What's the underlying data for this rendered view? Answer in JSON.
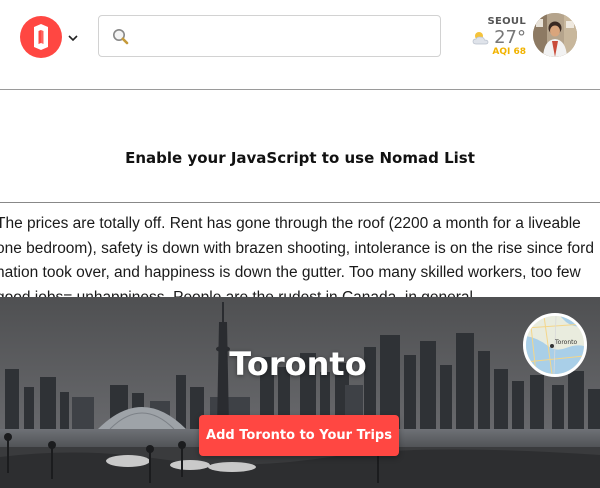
{
  "header": {
    "logo_icon": "nomad-list-logo",
    "logo_color": "#ff4742",
    "menu_icon": "chevron-down-icon",
    "search": {
      "icon": "search-icon",
      "value": "",
      "placeholder": ""
    },
    "weather": {
      "city": "SEOUL",
      "temperature": "27°",
      "aqi": "AQI 68",
      "icon": "partly-cloudy-icon",
      "aqi_color": "#f2b300"
    },
    "avatar_icon": "user-avatar"
  },
  "notice": {
    "text": "Enable your JavaScript to use Nomad List"
  },
  "review": {
    "lines": [
      "The prices are totally off. Rent has gone through the roof (2200 a month for a liveable",
      "one bedroom), safety is down with brazen shooting, intolerance is on the rise since ford",
      "nation took over, and happiness is down the gutter. Too many skilled workers, too few",
      "good jobs= unhappiness. People are the rudest in Canada, in general."
    ]
  },
  "hero": {
    "city": "Toronto",
    "add_button_label": "Add Toronto to Your Trips",
    "button_color": "#ff4742",
    "map_label": "Toronto"
  }
}
